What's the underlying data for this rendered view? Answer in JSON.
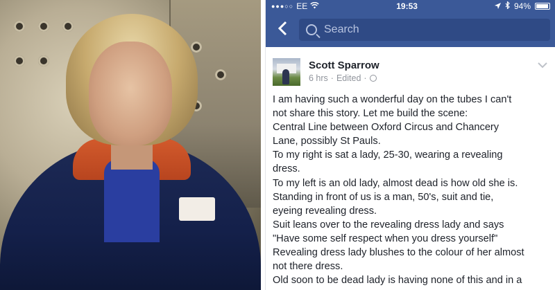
{
  "statusbar": {
    "carrier": "EE",
    "time": "19:53",
    "battery": "94%",
    "battery_level": 0.94
  },
  "navbar": {
    "back_icon": "chevron-left-icon",
    "search_placeholder": "Search"
  },
  "post": {
    "author": "Scott Sparrow",
    "time": "6 hrs",
    "edited": "Edited",
    "audience_icon": "globe-icon",
    "lines": [
      "I am having such a wonderful day on the tubes I can't",
      "not share this story. Let me build the scene:",
      "Central Line between Oxford Circus and Chancery",
      "Lane, possibly St Pauls.",
      "To my right is sat a lady, 25-30, wearing a revealing",
      "dress.",
      "To my left is an old lady, almost dead is how old she is.",
      "Standing in front of us is a man, 50's, suit and tie,",
      "eyeing revealing dress.",
      "Suit leans over to the revealing dress lady and says",
      "\"Have some self respect when you dress yourself\"",
      "Revealing dress lady blushes to the colour of her almost",
      "not there dress.",
      "Old soon to be dead lady is having none of this and in a"
    ]
  },
  "colors": {
    "facebook_blue": "#3b5998",
    "text": "#1d2129",
    "meta": "#90949c"
  }
}
